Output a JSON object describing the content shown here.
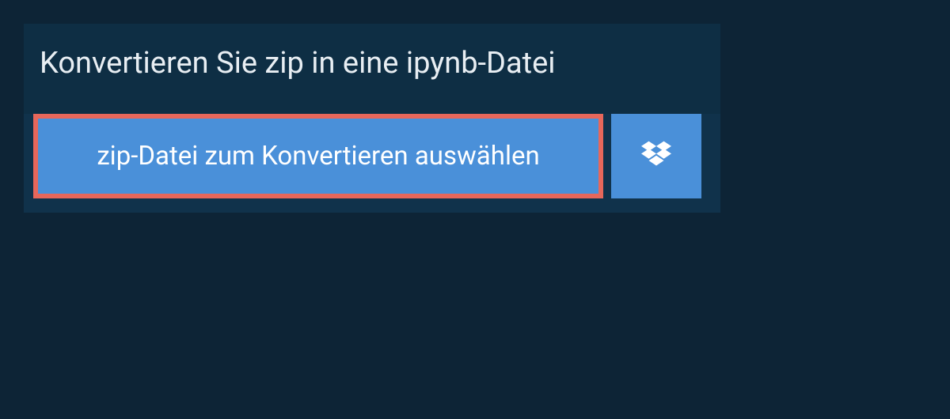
{
  "heading": "Konvertieren Sie zip in eine ipynb-Datei",
  "buttons": {
    "select_file": "zip-Datei zum Konvertieren auswählen"
  }
}
